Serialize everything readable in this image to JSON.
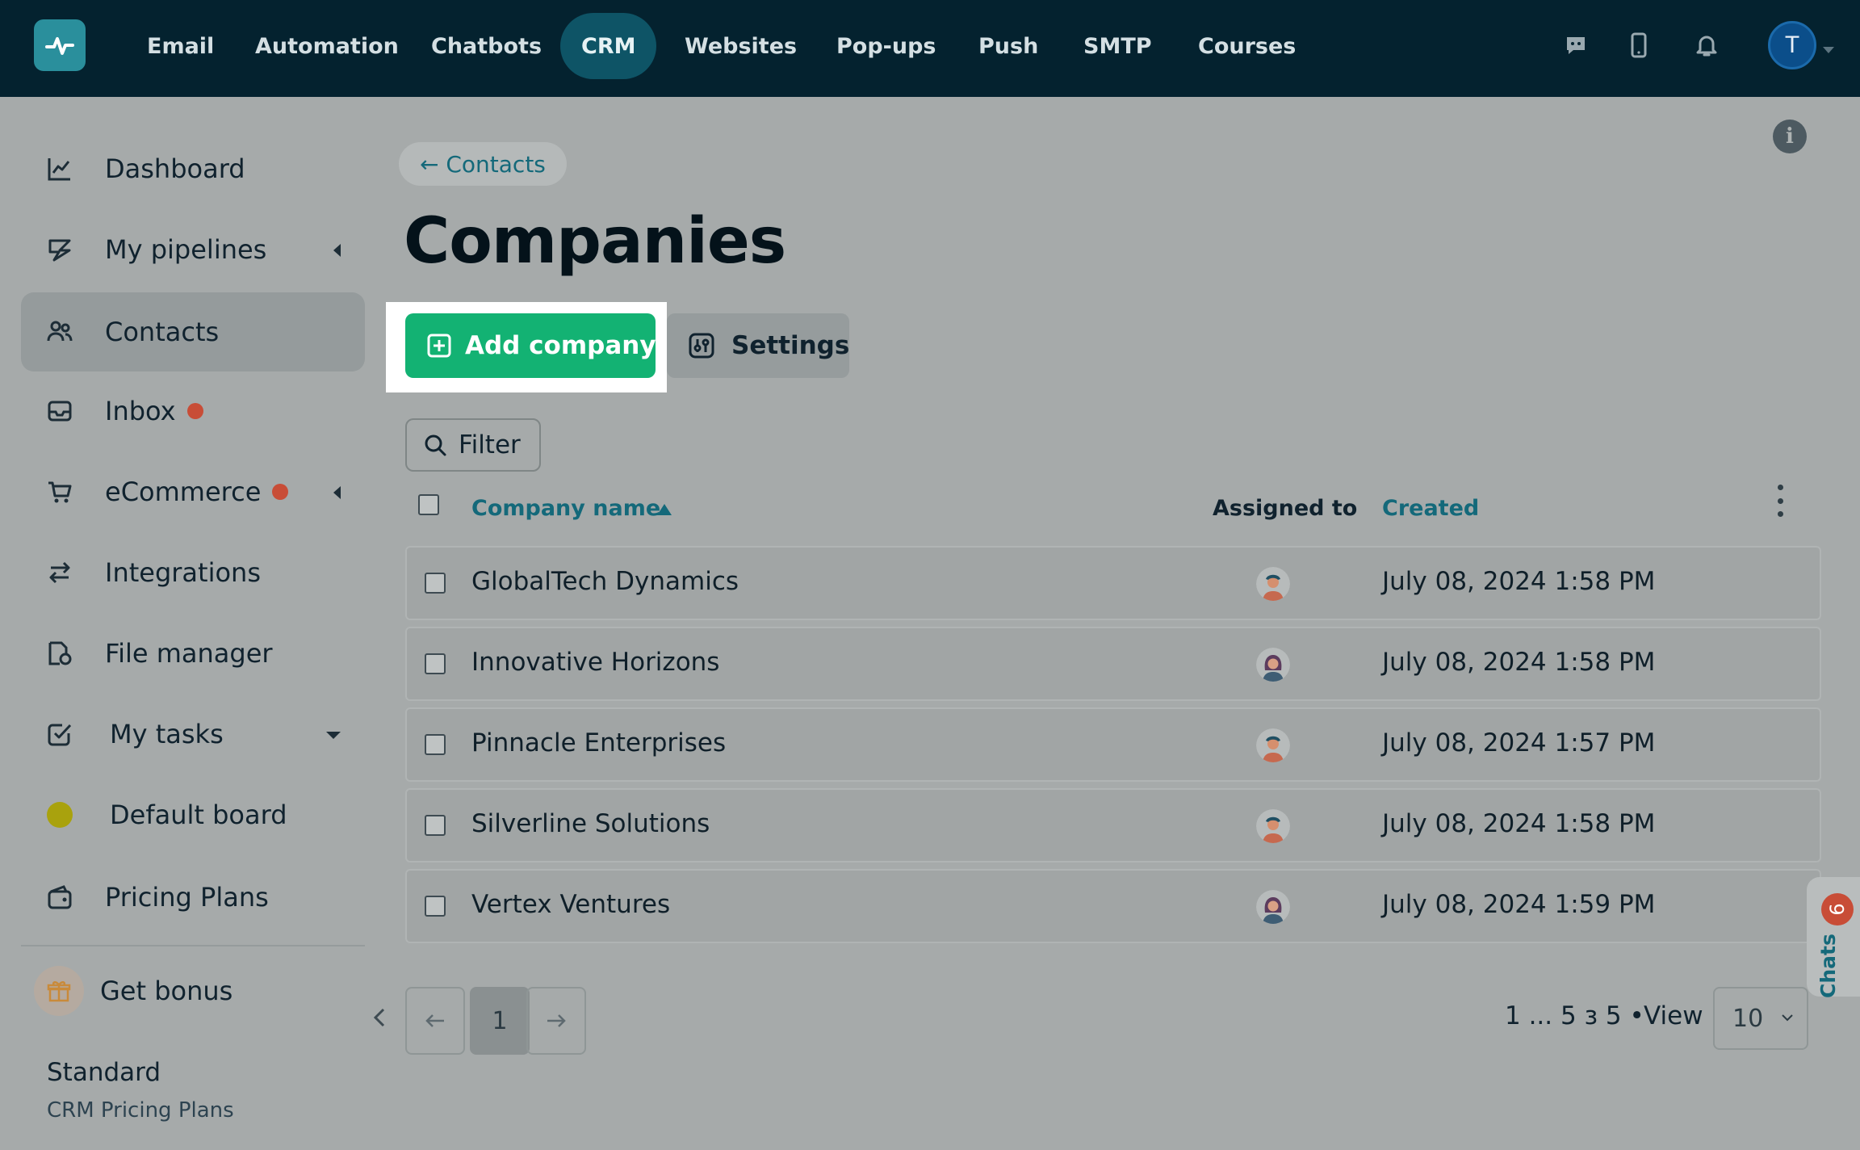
{
  "topnav": {
    "items": [
      {
        "label": "Email"
      },
      {
        "label": "Automation"
      },
      {
        "label": "Chatbots"
      },
      {
        "label": "CRM",
        "active": true
      },
      {
        "label": "Websites"
      },
      {
        "label": "Pop-ups"
      },
      {
        "label": "Push"
      },
      {
        "label": "SMTP"
      },
      {
        "label": "Courses"
      }
    ],
    "icons": [
      "chat-icon",
      "mobile-icon",
      "bell-icon"
    ],
    "avatar_initial": "T"
  },
  "sidebar": {
    "items": [
      {
        "label": "Dashboard",
        "icon": "chart-line-icon"
      },
      {
        "label": "My pipelines",
        "icon": "pipeline-icon",
        "caret": "left"
      },
      {
        "label": "Contacts",
        "icon": "people-icon",
        "active": true
      },
      {
        "label": "Inbox",
        "icon": "inbox-icon",
        "dot": true
      },
      {
        "label": "eCommerce",
        "icon": "cart-icon",
        "dot": true,
        "caret": "left"
      },
      {
        "label": "Integrations",
        "icon": "arrows-exchange-icon"
      },
      {
        "label": "File manager",
        "icon": "file-manager-icon"
      },
      {
        "label": "My tasks",
        "icon": "task-check-icon",
        "caret": "down"
      },
      {
        "label": "Default board",
        "icon": "board-dot-icon"
      },
      {
        "label": "Pricing Plans",
        "icon": "wallet-icon"
      }
    ],
    "bonus_label": "Get bonus",
    "plan": {
      "title": "Standard",
      "subtitle": "CRM Pricing Plans"
    }
  },
  "main": {
    "back_label": "← Contacts",
    "title": "Companies",
    "add_button": "Add company",
    "settings_button": "Settings",
    "filter_button": "Filter",
    "columns": {
      "name": "Company name",
      "assigned": "Assigned to",
      "created": "Created"
    },
    "rows": [
      {
        "name": "GlobalTech Dynamics",
        "avatar": "male",
        "created": "July 08, 2024 1:58 PM"
      },
      {
        "name": "Innovative Horizons",
        "avatar": "female",
        "created": "July 08, 2024 1:58 PM"
      },
      {
        "name": "Pinnacle Enterprises",
        "avatar": "male",
        "created": "July 08, 2024 1:57 PM"
      },
      {
        "name": "Silverline Solutions",
        "avatar": "male",
        "created": "July 08, 2024 1:58 PM"
      },
      {
        "name": "Vertex Ventures",
        "avatar": "female",
        "created": "July 08, 2024 1:59 PM"
      }
    ],
    "pagination": {
      "current": "1",
      "info": "1 ... 5 з 5 •",
      "view_label": "View",
      "page_size": "10"
    }
  },
  "chats": {
    "label": "Chats",
    "count": "6"
  },
  "colors": {
    "accent": "#13b273",
    "link": "#14697a",
    "topbar": "#04222f",
    "badge": "#c84d37"
  }
}
